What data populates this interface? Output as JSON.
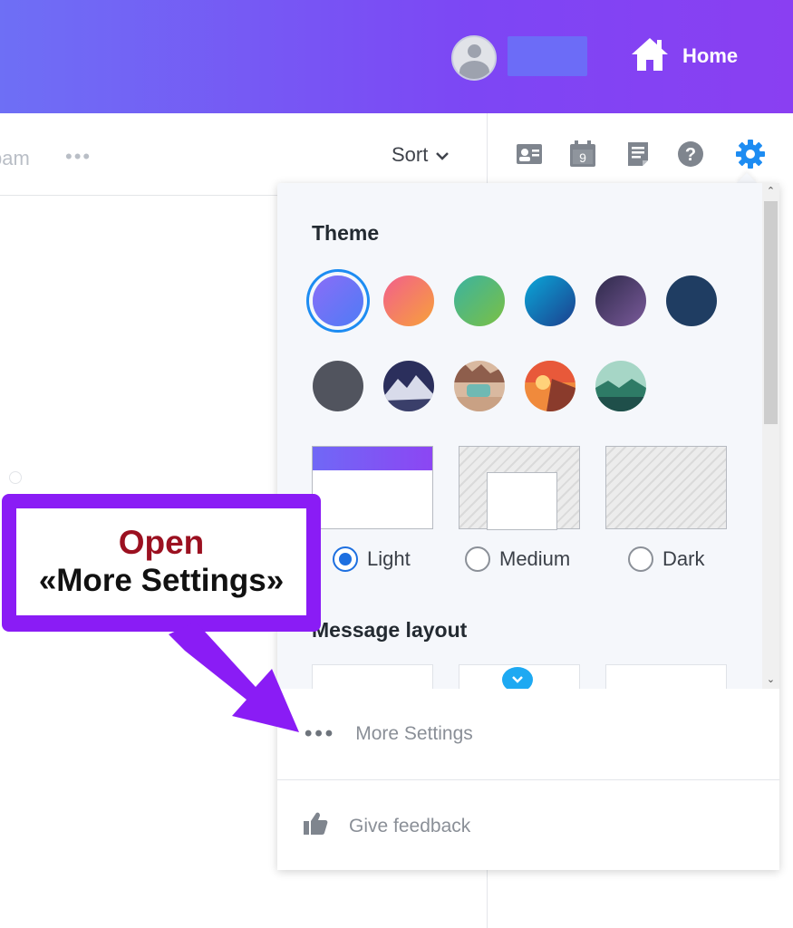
{
  "header": {
    "home_label": "Home",
    "icons": [
      "user-avatar-icon",
      "home-icon"
    ]
  },
  "mail": {
    "tab_partial": "pam",
    "more_tabs": "•••",
    "sort_label": "Sort"
  },
  "toolbar": {
    "icons": [
      "contacts-icon",
      "calendar-icon",
      "notepad-icon",
      "help-icon",
      "settings-gear-icon"
    ],
    "calendar_day": "9"
  },
  "settings_panel": {
    "theme_title": "Theme",
    "theme_colors": [
      {
        "name": "purple",
        "selected": true
      },
      {
        "name": "sunset-orange"
      },
      {
        "name": "green"
      },
      {
        "name": "blue"
      },
      {
        "name": "dusk-purple"
      },
      {
        "name": "navy"
      },
      {
        "name": "gray"
      },
      {
        "name": "mountain-night-photo"
      },
      {
        "name": "camper-desert-photo"
      },
      {
        "name": "autumn-sunset-photo"
      },
      {
        "name": "teal-landscape-photo"
      }
    ],
    "brightness_options": [
      {
        "label": "Light",
        "checked": true
      },
      {
        "label": "Medium",
        "checked": false
      },
      {
        "label": "Dark",
        "checked": false
      }
    ],
    "message_layout_title": "Message layout",
    "more_settings_dots": "•••",
    "more_settings_label": "More Settings",
    "feedback_label": "Give feedback"
  },
  "callout": {
    "line1": "Open",
    "line2": "«More Settings»"
  },
  "colors": {
    "header_start": "#6e6ff5",
    "header_end": "#8a3ff2",
    "accent_blue": "#1d8cf2",
    "callout_purple": "#8a1cf5",
    "callout_red": "#9b1020"
  }
}
